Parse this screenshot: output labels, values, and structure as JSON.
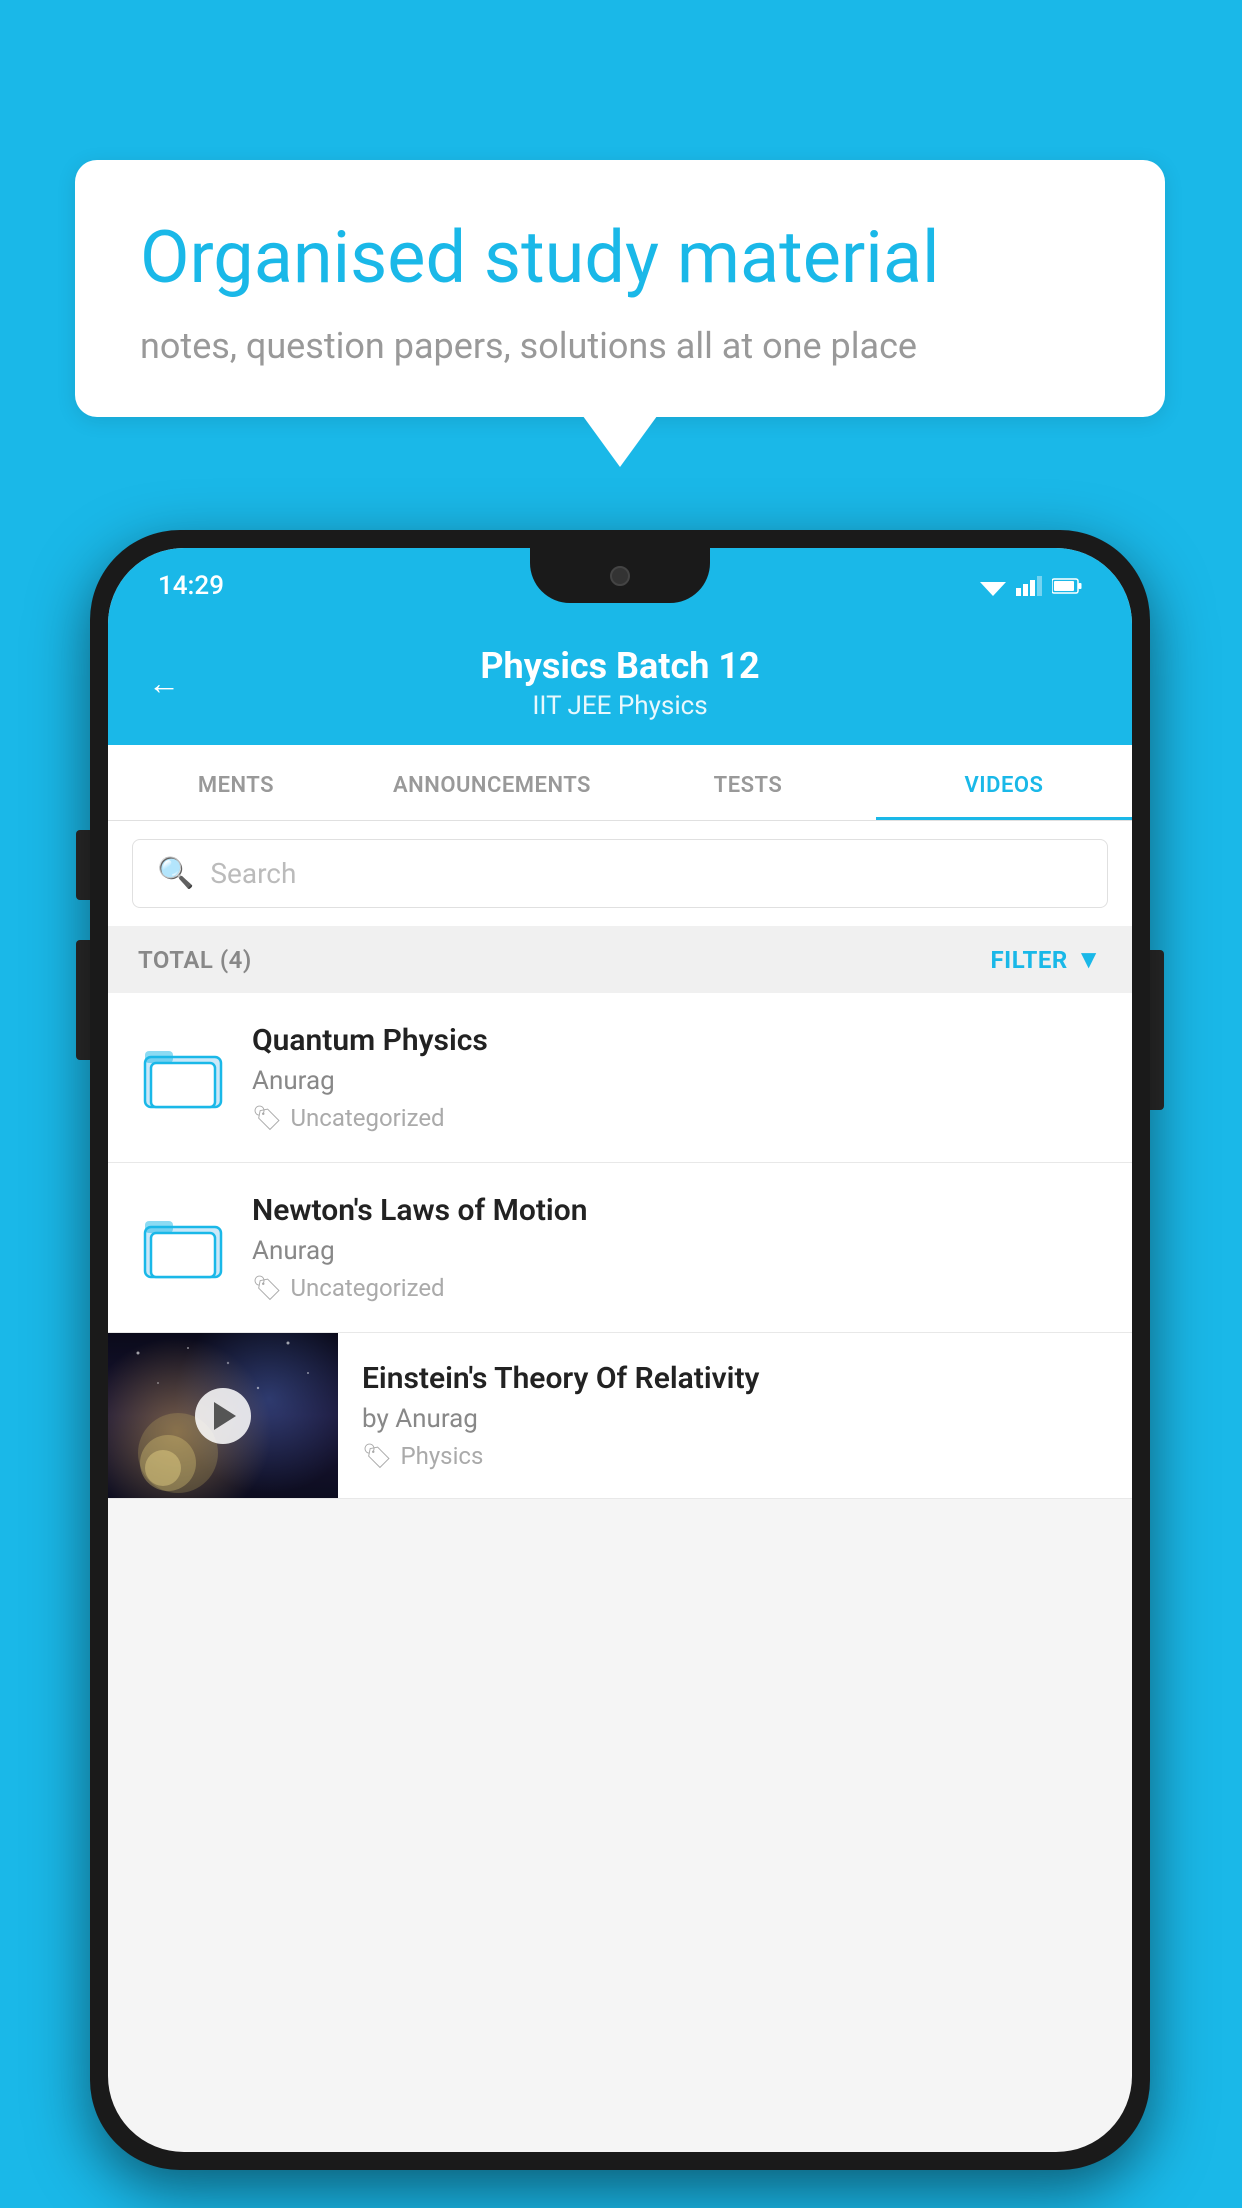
{
  "background": {
    "color": "#1ab8e8"
  },
  "speech_bubble": {
    "title": "Organised study material",
    "subtitle": "notes, question papers, solutions all at one place"
  },
  "status_bar": {
    "time": "14:29",
    "wifi_icon": "▼",
    "signal_icon": "▲",
    "battery_icon": "▮"
  },
  "header": {
    "back_label": "←",
    "title": "Physics Batch 12",
    "subtitle": "IIT JEE   Physics"
  },
  "tabs": [
    {
      "label": "MENTS",
      "active": false
    },
    {
      "label": "ANNOUNCEMENTS",
      "active": false
    },
    {
      "label": "TESTS",
      "active": false
    },
    {
      "label": "VIDEOS",
      "active": true
    }
  ],
  "search": {
    "placeholder": "Search"
  },
  "filter_bar": {
    "total_label": "TOTAL (4)",
    "filter_label": "FILTER"
  },
  "videos": [
    {
      "id": 1,
      "type": "folder",
      "title": "Quantum Physics",
      "author": "Anurag",
      "tag": "Uncategorized"
    },
    {
      "id": 2,
      "type": "folder",
      "title": "Newton's Laws of Motion",
      "author": "Anurag",
      "tag": "Uncategorized"
    },
    {
      "id": 3,
      "type": "video",
      "title": "Einstein's Theory Of Relativity",
      "author": "by Anurag",
      "tag": "Physics"
    }
  ]
}
